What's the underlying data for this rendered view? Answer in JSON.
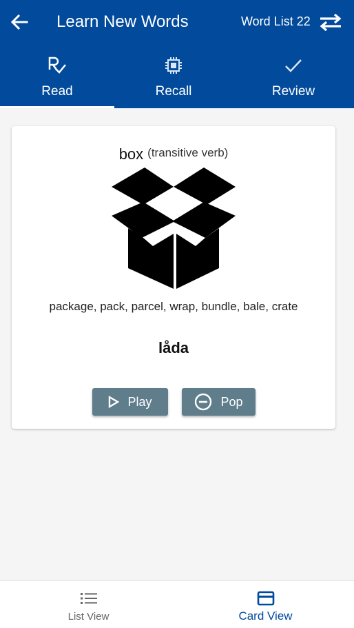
{
  "header": {
    "title": "Learn New Words",
    "word_list": "Word List 22",
    "background": "#024a9c"
  },
  "tabs": [
    {
      "label": "Read",
      "icon": "rx-check-icon",
      "active": true
    },
    {
      "label": "Recall",
      "icon": "chip-icon",
      "active": false
    },
    {
      "label": "Review",
      "icon": "check-icon",
      "active": false
    }
  ],
  "card": {
    "word": "box",
    "part_of_speech": "(transitive verb)",
    "image_icon": "open-box-icon",
    "synonyms": "package, pack, parcel, wrap, bundle, bale, crate",
    "translation": "låda",
    "play_label": "Play",
    "pop_label": "Pop",
    "button_color": "#607d8b"
  },
  "bottom_nav": {
    "items": [
      {
        "label": "List View",
        "icon": "list-icon",
        "active": false
      },
      {
        "label": "Card View",
        "icon": "card-icon",
        "active": true
      }
    ],
    "active_color": "#024a9c"
  }
}
